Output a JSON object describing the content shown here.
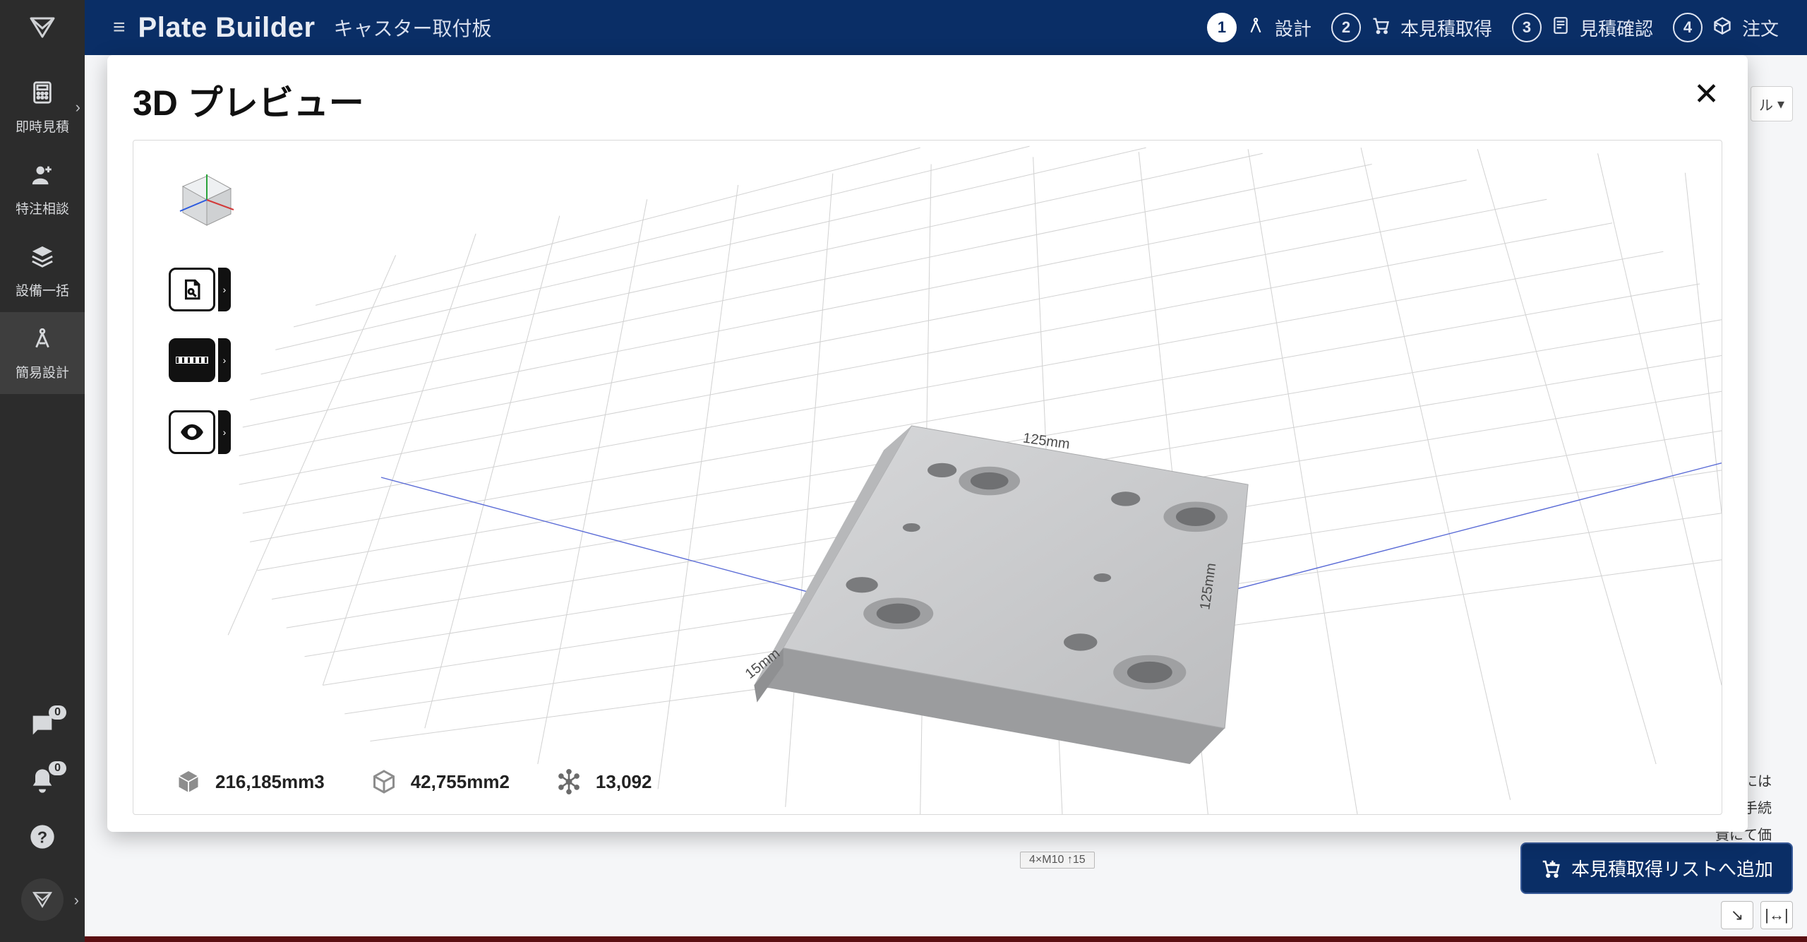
{
  "topbar": {
    "app_title": "Plate Builder",
    "subtitle": "キャスター取付板",
    "steps": [
      {
        "num": "1",
        "label": "設計",
        "active": true
      },
      {
        "num": "2",
        "label": "本見積取得",
        "active": false
      },
      {
        "num": "3",
        "label": "見積確認",
        "active": false
      },
      {
        "num": "4",
        "label": "注文",
        "active": false
      }
    ]
  },
  "leftnav": {
    "items": [
      {
        "label": "即時見積"
      },
      {
        "label": "特注相談"
      },
      {
        "label": "設備一括"
      },
      {
        "label": "簡易設計",
        "active": true
      }
    ],
    "chat_badge": "0",
    "bell_badge": "0"
  },
  "modal": {
    "title": "3D プレビュー"
  },
  "viewer": {
    "dimensions": {
      "width": "125mm",
      "depth": "125mm",
      "thickness": "15mm"
    },
    "stats": {
      "volume": "216,185mm3",
      "area": "42,755mm2",
      "triangles": "13,092"
    }
  },
  "background": {
    "dropdown_hint": "ル",
    "right_text_1": "するには",
    "right_text_2": "取得手続",
    "right_text_3": "責にて価",
    "bottom_chip": "4×M10  ↑15",
    "add_button_label": "本見積取得リストへ追加"
  }
}
